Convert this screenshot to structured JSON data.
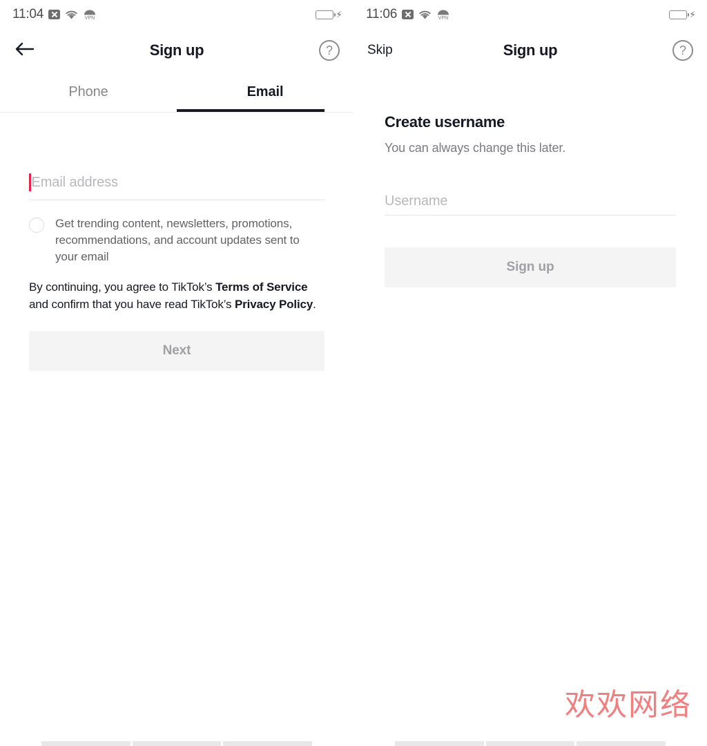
{
  "screens": [
    {
      "id": "email-signup",
      "statusbar": {
        "time": "11:04",
        "icons": [
          "x-icon",
          "wifi-icon",
          "vpn-icon"
        ],
        "battery": "battery-charging-icon"
      },
      "navbar": {
        "back_icon": "back-arrow-icon",
        "title": "Sign up",
        "help_icon": "help-circle-icon"
      },
      "tabs": [
        {
          "label": "Phone",
          "active": false
        },
        {
          "label": "Email",
          "active": true
        }
      ],
      "email_input": {
        "placeholder": "Email address",
        "value": "",
        "caret_color": "#e8244a",
        "focused": true
      },
      "marketing_optin": {
        "checked": false,
        "label": "Get trending content, newsletters, promotions, recommendations, and account updates sent to your email"
      },
      "legal": {
        "part1": "By continuing, you agree to TikTok’s ",
        "terms": "Terms of Service",
        "part2": " and confirm that you have read TikTok’s ",
        "privacy": "Privacy Policy",
        "part3": "."
      },
      "primary_button": {
        "label": "Next",
        "enabled": false,
        "background": "#f4f4f4",
        "text_color": "#a0a0a5"
      }
    },
    {
      "id": "create-username",
      "statusbar": {
        "time": "11:06",
        "icons": [
          "x-icon",
          "wifi-icon",
          "vpn-icon"
        ],
        "battery": "battery-charging-icon"
      },
      "navbar": {
        "skip_label": "Skip",
        "title": "Sign up",
        "help_icon": "help-circle-icon"
      },
      "heading": "Create username",
      "subheading": "You can always change this later.",
      "username_input": {
        "placeholder": "Username",
        "value": ""
      },
      "primary_button": {
        "label": "Sign up",
        "enabled": false,
        "background": "#f4f4f4",
        "text_color": "#a0a0a5"
      }
    }
  ],
  "watermark": {
    "text": "欢欢网络",
    "color": "#f08080"
  }
}
